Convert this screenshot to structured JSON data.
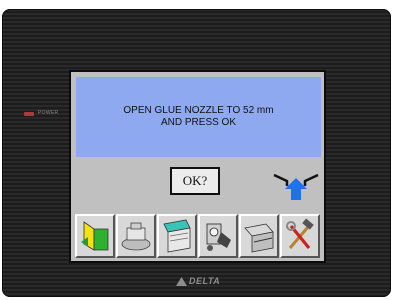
{
  "device": {
    "power_label": "POWER",
    "brand": "DELTA"
  },
  "message": {
    "line1": "OPEN GLUE NOZZLE TO 52 mm",
    "line2": "AND PRESS OK"
  },
  "ok_button": {
    "label": "OK?"
  },
  "toolbar": {
    "items": [
      {
        "icon": "edge-folder-icon"
      },
      {
        "icon": "glue-machine-icon"
      },
      {
        "icon": "edge-tape-roll-icon"
      },
      {
        "icon": "feeder-mechanism-icon"
      },
      {
        "icon": "edge-trimmer-icon"
      },
      {
        "icon": "hammer-wrench-tools-icon"
      }
    ]
  },
  "colors": {
    "message_bg": "#8ea9ef",
    "screen_bg": "#c0c0c0",
    "arrow_blue": "#1e73e6",
    "power_led": "#b03a3a"
  }
}
